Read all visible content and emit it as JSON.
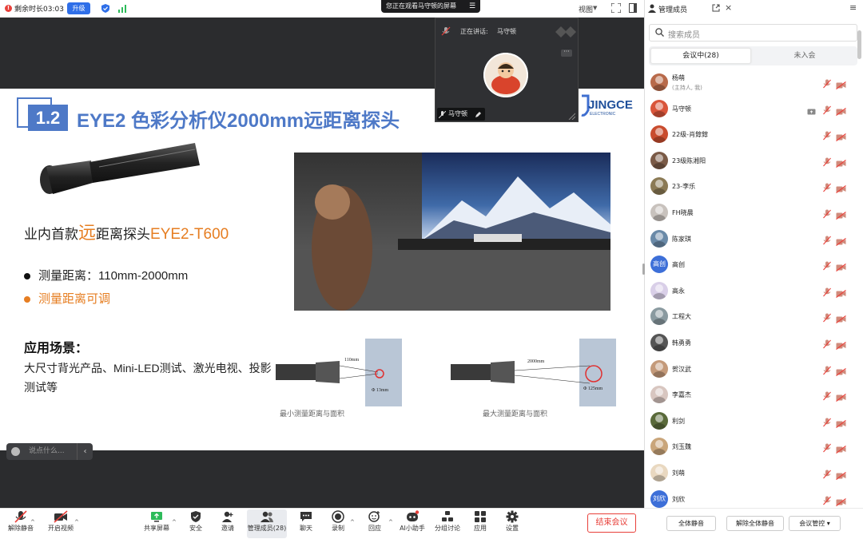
{
  "topbar": {
    "timer_label": "剩余时长03:03",
    "upgrade_label": "升级",
    "view_label": "视图"
  },
  "share_banner": {
    "text": "您正在观看马守顿的屏幕"
  },
  "video": {
    "speaking_label": "正在讲话:",
    "speaker_name": "马守顿",
    "more_label": "···",
    "name_tag": "马守顿"
  },
  "slide": {
    "number": "1.2",
    "title": "EYE2 色彩分析仪2000mm远距离探头",
    "headline_prefix": "业内首款",
    "headline_highlight": "远",
    "headline_mid": "距离探头",
    "headline_model": "EYE2-T600",
    "bullet1": "测量距离：110mm-2000mm",
    "bullet2": "测量距离可调",
    "scene_title": "应用场景：",
    "scene_text": "大尺寸背光产品、Mini-LED测试、激光电视、投影测试等",
    "diagram_min_distance": "110mm",
    "diagram_min_area": "Φ 13mm",
    "diagram_max_distance": "2000mm",
    "diagram_max_area": "Φ 125mm",
    "caption_min": "最小测量距离与面积",
    "caption_max": "最大测量距离与面积",
    "logo_text": "JINGCE",
    "logo_subtext": "ELECTRONIC"
  },
  "chat": {
    "placeholder": "说点什么..."
  },
  "toolbar": {
    "items": [
      {
        "label": "解除静音"
      },
      {
        "label": "开启视频"
      },
      {
        "label": "共享屏幕"
      },
      {
        "label": "安全"
      },
      {
        "label": "邀请"
      },
      {
        "label": "管理成员(28)"
      },
      {
        "label": "聊天"
      },
      {
        "label": "录制"
      },
      {
        "label": "回应"
      },
      {
        "label": "AI小助手"
      },
      {
        "label": "分组讨论"
      },
      {
        "label": "应用"
      },
      {
        "label": "设置"
      }
    ],
    "end_label": "结束会议"
  },
  "panel": {
    "title": "管理成员",
    "search_placeholder": "搜索成员",
    "tab_in": "会议中(28)",
    "tab_out": "未入会",
    "members": [
      {
        "name": "杨萌",
        "sub": "(主持人, 我)",
        "avatar": "img",
        "color": "#b86a4a"
      },
      {
        "name": "马守顿",
        "sub": "",
        "avatar": "img",
        "color": "#d9553a",
        "screen": true
      },
      {
        "name": "22级-肖錞錞",
        "sub": "",
        "avatar": "img",
        "color": "#c94c2e"
      },
      {
        "name": "23级陈湘阳",
        "sub": "",
        "avatar": "img",
        "color": "#7a5a46"
      },
      {
        "name": "23-李乐",
        "sub": "",
        "avatar": "img",
        "color": "#8b7a55"
      },
      {
        "name": "FH晓晨",
        "sub": "",
        "avatar": "img",
        "color": "#c8c2bd"
      },
      {
        "name": "陈家琪",
        "sub": "",
        "avatar": "img",
        "color": "#6a8aa8"
      },
      {
        "name": "高创",
        "sub": "",
        "avatar": "text",
        "text": "高创",
        "color": "#3d6fd8"
      },
      {
        "name": "高永",
        "sub": "",
        "avatar": "img",
        "color": "#d9cfe8"
      },
      {
        "name": "工程大",
        "sub": "",
        "avatar": "img",
        "color": "#8a9aa0"
      },
      {
        "name": "韩勇勇",
        "sub": "",
        "avatar": "img",
        "color": "#555"
      },
      {
        "name": "贺汉武",
        "sub": "",
        "avatar": "img",
        "color": "#c49a7a"
      },
      {
        "name": "李嘉杰",
        "sub": "",
        "avatar": "img",
        "color": "#d8c6c0"
      },
      {
        "name": "利剑",
        "sub": "",
        "avatar": "img",
        "color": "#5a6a3a"
      },
      {
        "name": "刘玉魏",
        "sub": "",
        "avatar": "img",
        "color": "#c9a57a"
      },
      {
        "name": "刘萌",
        "sub": "",
        "avatar": "img",
        "color": "#e9d8c0"
      },
      {
        "name": "刘欣",
        "sub": "",
        "avatar": "text",
        "text": "刘欣",
        "color": "#3d6fd8"
      }
    ],
    "footer": {
      "mute_all": "全体静音",
      "unmute_all": "解除全体静音",
      "control": "会议管控"
    }
  }
}
